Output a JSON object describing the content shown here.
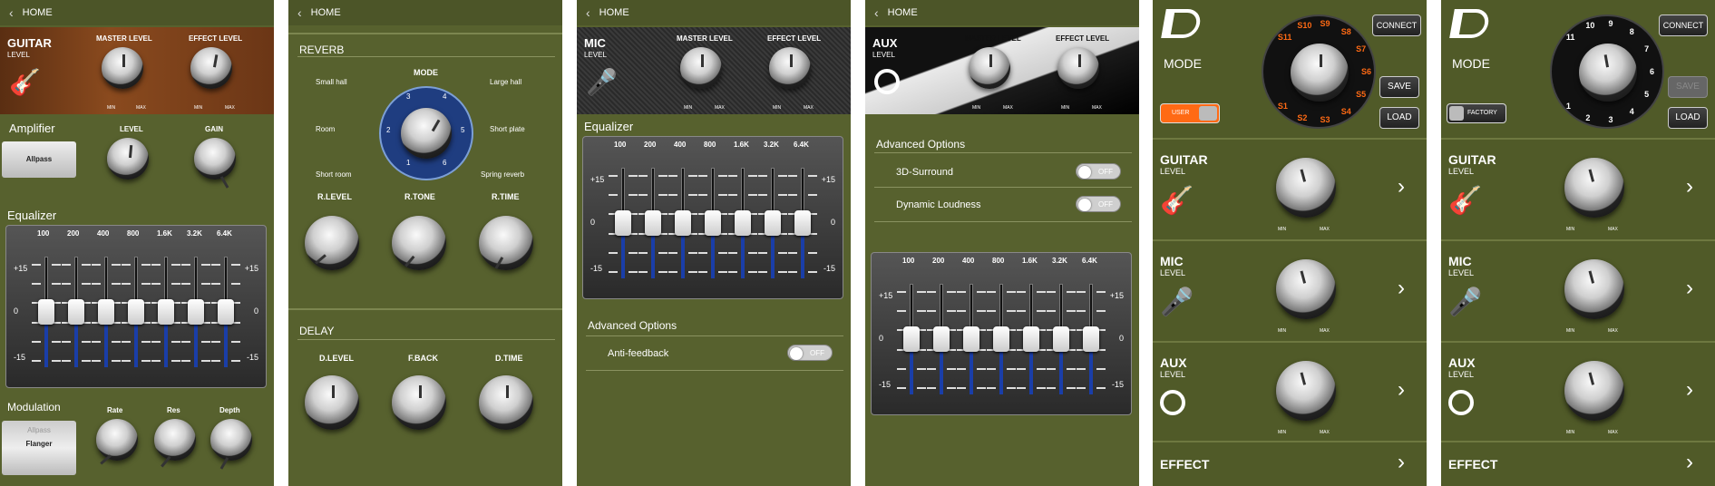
{
  "common": {
    "home": "HOME",
    "min": "MIN",
    "max": "MAX",
    "chev": "‹"
  },
  "p1": {
    "title": "GUITAR",
    "sub": "LEVEL",
    "master": "MASTER LEVEL",
    "effect": "EFFECT LEVEL",
    "amp": "Amplifier",
    "amp_level": "LEVEL",
    "amp_gain": "GAIN",
    "allpass": "Allpass",
    "eq": "Equalizer",
    "mod": "Modulation",
    "rate": "Rate",
    "res": "Res",
    "depth": "Depth",
    "flanger": "Flanger",
    "allpass2": "Allpass"
  },
  "eq": {
    "freqs": [
      "100",
      "200",
      "400",
      "800",
      "1.6K",
      "3.2K",
      "6.4K"
    ],
    "p15": "+15",
    "zero": "0",
    "m15": "-15"
  },
  "p2": {
    "reverb": "REVERB",
    "mode": "MODE",
    "small_hall": "Small hall",
    "large_hall": "Large hall",
    "room": "Room",
    "short_plate": "Short plate",
    "short_room": "Short room",
    "spring_reverb": "Spring reverb",
    "rlevel": "R.LEVEL",
    "rtone": "R.TONE",
    "rtime": "R.TIME",
    "delay": "DELAY",
    "dlevel": "D.LEVEL",
    "fback": "F.BACK",
    "dtime": "D.TIME",
    "n1": "1",
    "n2": "2",
    "n3": "3",
    "n4": "4",
    "n5": "5",
    "n6": "6"
  },
  "p3": {
    "title": "MIC",
    "sub": "LEVEL",
    "master": "MASTER LEVEL",
    "effect": "EFFECT LEVEL",
    "eq": "Equalizer",
    "adv": "Advanced Options",
    "anti": "Anti-feedback",
    "off": "OFF"
  },
  "p4": {
    "title": "AUX",
    "sub": "LEVEL",
    "master": "MASTER LEVEL",
    "effect": "EFFECT LEVEL",
    "adv": "Advanced Options",
    "surround": "3D-Surround",
    "loud": "Dynamic Loudness",
    "off": "OFF"
  },
  "p5": {
    "mode": "MODE",
    "connect": "CONNECT",
    "save": "SAVE",
    "load": "LOAD",
    "toggle": "USER",
    "dial": [
      "S1",
      "S2",
      "S3",
      "S4",
      "S5",
      "S6",
      "S7",
      "S8",
      "S9",
      "S10",
      "S11"
    ],
    "guitar": "GUITAR",
    "mic": "MIC",
    "aux": "AUX",
    "level": "LEVEL",
    "effect": "EFFECT",
    "chev": "›"
  },
  "p6": {
    "mode": "MODE",
    "connect": "CONNECT",
    "save": "SAVE",
    "load": "LOAD",
    "toggle": "FACTORY",
    "dial": [
      "1",
      "2",
      "3",
      "4",
      "5",
      "6",
      "7",
      "8",
      "9",
      "10",
      "11"
    ],
    "guitar": "GUITAR",
    "mic": "MIC",
    "aux": "AUX",
    "level": "LEVEL",
    "effect": "EFFECT",
    "chev": "›"
  }
}
